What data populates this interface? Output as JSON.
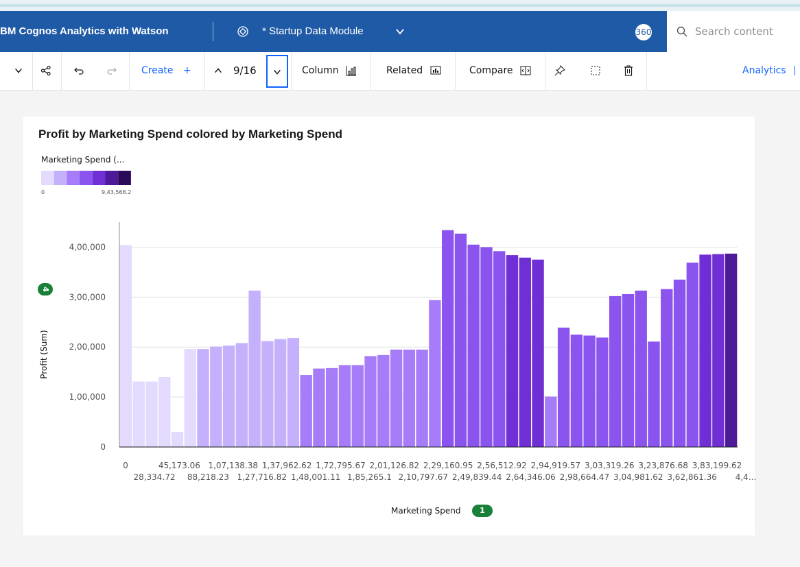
{
  "app": {
    "brand": "BM Cognos Analytics with Watson",
    "module_name": "* Startup Data Module",
    "badge": "360",
    "search_placeholder": "Search content"
  },
  "toolbar": {
    "create_label": "Create",
    "create_plus": "+",
    "nav_count": "9/16",
    "column_label": "Column",
    "related_label": "Related",
    "compare_label": "Compare",
    "analytics_label": "Analytics"
  },
  "chart_data": {
    "type": "bar",
    "title": "Profit by Marketing Spend colored by Marketing Spend",
    "xlabel": "Marketing Spend",
    "ylabel": "Profit (Sum)",
    "x_badge": "1",
    "y_badge": "4",
    "legend": {
      "title": "Marketing Spend (...",
      "min": "0",
      "max": "9,43,568.2"
    },
    "colors": [
      "#e3dafe",
      "#c4b0fb",
      "#a77cf9",
      "#8b54ee",
      "#6f2fd4",
      "#4d1b9a",
      "#2b0a59"
    ],
    "ylim": [
      0,
      450000
    ],
    "yticks": [
      "0",
      "1,00,000",
      "2,00,000",
      "3,00,000",
      "4,00,000"
    ],
    "xtick_row1": [
      "0",
      "45,173.06",
      "1,07,138.38",
      "1,37,962.62",
      "1,72,795.67",
      "2,01,126.82",
      "2,29,160.95",
      "2,56,512.92",
      "2,94,919.57",
      "3,03,319.26",
      "3,23,876.68",
      "3,83,199.62"
    ],
    "xtick_row2": [
      "28,334.72",
      "88,218.23",
      "1,27,716.82",
      "1,48,001.11",
      "1,85,265.1",
      "2,10,797.67",
      "2,49,839.44",
      "2,64,346.06",
      "2,98,664.47",
      "3,04,981.62",
      "3,62,861.36",
      "4,4..."
    ],
    "values": [
      404000,
      131000,
      131000,
      140000,
      30000,
      196000,
      196000,
      201000,
      203000,
      208000,
      313000,
      212000,
      216000,
      218000,
      144000,
      157000,
      158000,
      164000,
      164000,
      182000,
      184000,
      195000,
      195000,
      195000,
      294000,
      434000,
      427000,
      405000,
      400000,
      392000,
      384000,
      379000,
      375000,
      101000,
      239000,
      225000,
      223000,
      219000,
      302000,
      306000,
      313000,
      211000,
      316000,
      335000,
      369000,
      385000,
      386000,
      387000
    ],
    "color_index": [
      0,
      0,
      0,
      0,
      0,
      0,
      1,
      1,
      1,
      1,
      1,
      1,
      1,
      1,
      2,
      2,
      2,
      2,
      2,
      2,
      2,
      2,
      2,
      2,
      2,
      3,
      3,
      3,
      3,
      3,
      4,
      4,
      4,
      2,
      3,
      3,
      3,
      3,
      3,
      3,
      3,
      3,
      3,
      3,
      3,
      4,
      4,
      5
    ]
  }
}
